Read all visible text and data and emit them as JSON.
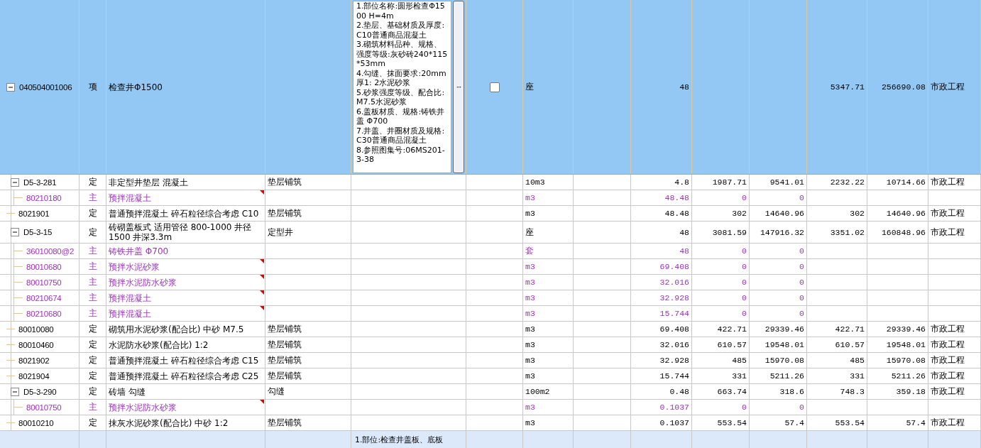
{
  "rows": [
    {
      "kind": "item",
      "selected": true,
      "expanded": true,
      "code": "040504001006",
      "type": "项",
      "name": "检查井Φ1500",
      "description": [
        "1.部位名称:圆形检查Φ1500 H=4m",
        "2.垫层、基础材质及厚度:C10普通商品混凝土",
        "3.砌筑材料品种、规格、强度等级:灰砂砖240*115*53mm",
        "4.勾缝、抹面要求:20mm厚1: 2水泥砂浆",
        "5.砂浆强度等级、配合比:M7.5水泥砂浆",
        "6.盖板材质、规格:铸铁井盖 Φ700",
        "7.井盖、井圈材质及规格:C30普通商品混凝土",
        "8.参照图集号:06MS201-3-38"
      ],
      "more_button": "···",
      "checked": false,
      "unit": "座",
      "qty": "48",
      "price2": "5347.71",
      "total2": "256690.08",
      "specialty": "市政工程",
      "children": [
        {
          "kind": "quota",
          "expanded": true,
          "code": "D5-3-281",
          "type": "定",
          "name": "非定型井垫层 混凝土",
          "feature": "垫层铺筑",
          "unit": "10m3",
          "qty": "4.8",
          "price": "1987.71",
          "total": "9541.01",
          "price2": "2232.22",
          "total2": "10714.66",
          "specialty": "市政工程",
          "children": [
            {
              "kind": "main",
              "flagged": true,
              "code": "80210180",
              "type": "主",
              "name": "预拌混凝土",
              "unit": "m3",
              "qty": "48.48",
              "price": "0",
              "total": "0"
            }
          ]
        },
        {
          "kind": "quota",
          "code": "8021901",
          "type": "定",
          "name": "普通预拌混凝土 碎石粒径综合考虑 C10",
          "feature": "垫层铺筑",
          "unit": "m3",
          "qty": "48.48",
          "price": "302",
          "total": "14640.96",
          "price2": "302",
          "total2": "14640.96",
          "specialty": "市政工程"
        },
        {
          "kind": "quota",
          "expanded": true,
          "code": "D5-3-15",
          "type": "定",
          "name": "砖砌盖板式 适用管径 800-1000 井径1500 井深3.3m",
          "feature": "定型井",
          "unit": "座",
          "qty": "48",
          "price": "3081.59",
          "total": "147916.32",
          "price2": "3351.02",
          "total2": "160848.96",
          "specialty": "市政工程",
          "children": [
            {
              "kind": "main",
              "flagged": false,
              "code": "36010080@2",
              "type": "主",
              "name": "铸铁井盖 Φ700",
              "unit": "套",
              "qty": "48",
              "price": "0",
              "total": "0"
            },
            {
              "kind": "main",
              "flagged": true,
              "code": "80010680",
              "type": "主",
              "name": "预拌水泥砂浆",
              "unit": "m3",
              "qty": "69.408",
              "price": "0",
              "total": "0"
            },
            {
              "kind": "main",
              "flagged": true,
              "code": "80010750",
              "type": "主",
              "name": "预拌水泥防水砂浆",
              "unit": "m3",
              "qty": "32.016",
              "price": "0",
              "total": "0"
            },
            {
              "kind": "main",
              "flagged": true,
              "code": "80210674",
              "type": "主",
              "name": "预拌混凝土",
              "unit": "m3",
              "qty": "32.928",
              "price": "0",
              "total": "0"
            },
            {
              "kind": "main",
              "flagged": true,
              "code": "80210680",
              "type": "主",
              "name": "预拌混凝土",
              "unit": "m3",
              "qty": "15.744",
              "price": "0",
              "total": "0"
            }
          ]
        },
        {
          "kind": "quota",
          "code": "80010080",
          "type": "定",
          "name": "砌筑用水泥砂浆(配合比) 中砂 M7.5",
          "feature": "垫层铺筑",
          "unit": "m3",
          "qty": "69.408",
          "price": "422.71",
          "total": "29339.46",
          "price2": "422.71",
          "total2": "29339.46",
          "specialty": "市政工程"
        },
        {
          "kind": "quota",
          "code": "80010460",
          "type": "定",
          "name": "水泥防水砂浆(配合比) 1:2",
          "feature": "垫层铺筑",
          "unit": "m3",
          "qty": "32.016",
          "price": "610.57",
          "total": "19548.01",
          "price2": "610.57",
          "total2": "19548.01",
          "specialty": "市政工程"
        },
        {
          "kind": "quota",
          "code": "8021902",
          "type": "定",
          "name": "普通预拌混凝土 碎石粒径综合考虑 C15",
          "feature": "垫层铺筑",
          "unit": "m3",
          "qty": "32.928",
          "price": "485",
          "total": "15970.08",
          "price2": "485",
          "total2": "15970.08",
          "specialty": "市政工程"
        },
        {
          "kind": "quota",
          "code": "8021904",
          "type": "定",
          "name": "普通预拌混凝土 碎石粒径综合考虑 C25",
          "feature": "垫层铺筑",
          "unit": "m3",
          "qty": "15.744",
          "price": "331",
          "total": "5211.26",
          "price2": "331",
          "total2": "5211.26",
          "specialty": "市政工程"
        },
        {
          "kind": "quota",
          "expanded": true,
          "code": "D5-3-290",
          "type": "定",
          "name": "砖墙 勾缝",
          "feature": "勾缝",
          "unit": "100m2",
          "qty": "0.48",
          "price": "663.74",
          "total": "318.6",
          "price2": "748.3",
          "total2": "359.18",
          "specialty": "市政工程",
          "children": [
            {
              "kind": "main",
              "flagged": true,
              "code": "80010750",
              "type": "主",
              "name": "预拌水泥防水砂浆",
              "unit": "m3",
              "qty": "0.1037",
              "price": "0",
              "total": "0"
            }
          ]
        },
        {
          "kind": "quota",
          "code": "80010210",
          "type": "定",
          "name": "抹灰水泥砂浆(配合比) 中砂 1:2",
          "feature": "垫层铺筑",
          "unit": "m3",
          "qty": "0.1037",
          "price": "553.54",
          "total": "57.4",
          "price2": "553.54",
          "total2": "57.4",
          "specialty": "市政工程"
        }
      ]
    },
    {
      "kind": "item",
      "selected": false,
      "description": [
        "1.部位:检查井盖板、底板"
      ]
    }
  ]
}
